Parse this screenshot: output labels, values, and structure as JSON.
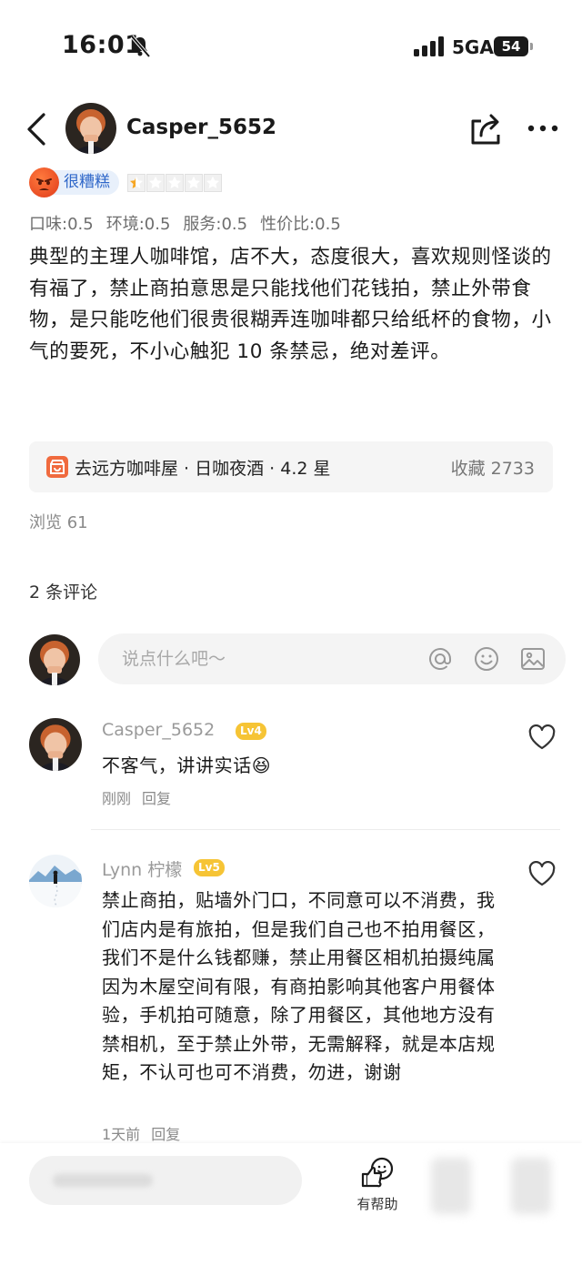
{
  "status_bar": {
    "time": "16:01",
    "network": "5GA",
    "battery": "54"
  },
  "header": {
    "username": "Casper_5652"
  },
  "rating": {
    "label": "很糟糕",
    "stars": 0.5,
    "stars_max": 5
  },
  "scores": [
    {
      "text": "口味:0.5"
    },
    {
      "text": "环境:0.5"
    },
    {
      "text": "服务:0.5"
    },
    {
      "text": "性价比:0.5"
    }
  ],
  "review": {
    "text": "典型的主理人咖啡馆，店不大，态度很大，喜欢规则怪谈的有福了，禁止商拍意思是只能找他们花钱拍，禁止外带食物，是只能吃他们很贵很糊弄连咖啡都只给纸杯的食物，小气的要死，不小心触犯 10 条禁忌，绝对差评。"
  },
  "shop": {
    "name": "去远方咖啡屋 · 日咖夜酒 · 4.2 星",
    "favorites": "收藏 2733"
  },
  "views": "浏览 61",
  "comments_header": "2 条评论",
  "comment_input": {
    "placeholder": "说点什么吧～"
  },
  "comments": [
    {
      "name": "Casper_5652",
      "level": "Lv4",
      "text": "不客气，讲讲实话😆",
      "time": "刚刚",
      "reply": "回复"
    },
    {
      "name": "Lynn 柠檬",
      "level": "Lv5",
      "text": "禁止商拍，贴墙外门口，不同意可以不消费，我们店内是有旅拍，但是我们自己也不拍用餐区，我们不是什么钱都赚，禁止用餐区相机拍摄纯属因为木屋空间有限，有商拍影响其他客户用餐体验，手机拍可随意，除了用餐区，其他地方没有禁相机，至于禁止外带，无需解释，就是本店规矩，不认可也可不消费，勿进，谢谢",
      "time": "1天前",
      "reply": "回复"
    }
  ],
  "bottom_bar": {
    "helpful_label": "有帮助"
  },
  "colors": {
    "accent_blue": "#2f67c9",
    "badge_yellow": "#f6c435",
    "shop_orange": "#f06a3e"
  }
}
